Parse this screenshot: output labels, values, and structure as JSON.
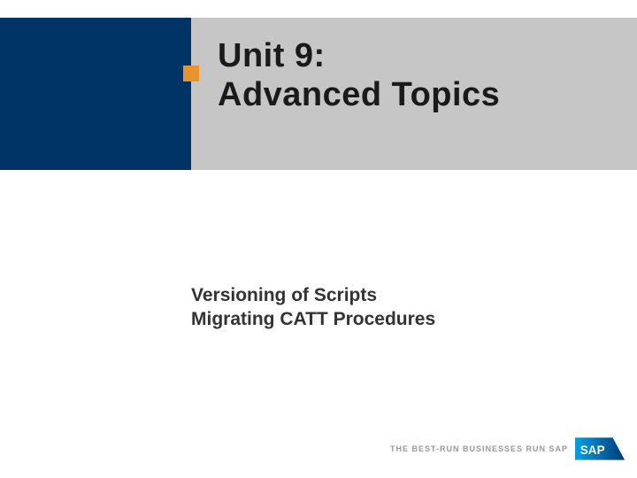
{
  "header": {
    "title_line1": "Unit 9:",
    "title_line2": "Advanced Topics"
  },
  "subtitle": {
    "line1": "Versioning of Scripts",
    "line2": "Migrating CATT Procedures"
  },
  "footer": {
    "tagline": "THE BEST-RUN BUSINESSES RUN SAP",
    "logo_text": "SAP"
  },
  "colors": {
    "navy": "#003366",
    "grey": "#c6c6c6",
    "orange": "#e8932e",
    "sap_blue": "#0066b3"
  }
}
